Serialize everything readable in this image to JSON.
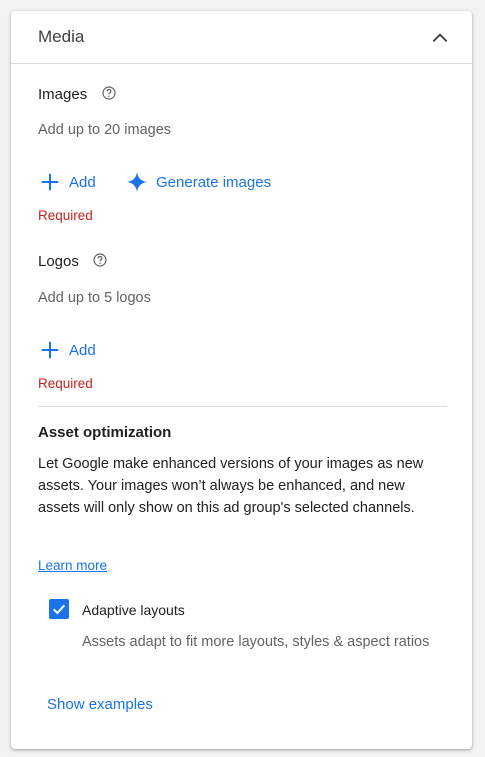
{
  "panel": {
    "title": "Media",
    "collapse_icon": "chevron-up-icon"
  },
  "images": {
    "title": "Images",
    "help_icon": "help-circle-icon",
    "hint": "Add up to 20 images",
    "add_label": "Add",
    "generate_label": "Generate images",
    "generate_icon": "sparkle-icon",
    "required": "Required"
  },
  "logos": {
    "title": "Logos",
    "help_icon": "help-circle-icon",
    "hint": "Add up to 5 logos",
    "add_label": "Add",
    "required": "Required"
  },
  "asset_optimization": {
    "title": "Asset optimization",
    "description": "Let Google make enhanced versions of your images as new assets. Your images won’t always be enhanced, and new assets will only show on this ad group's selected channels.",
    "learn_more": "Learn more",
    "adaptive_layouts": {
      "label": "Adaptive layouts",
      "checked": true,
      "description": "Assets adapt to fit more layouts, styles & aspect ratios"
    },
    "show_examples": "Show examples"
  },
  "colors": {
    "accent": "#1a73e8",
    "error": "#c5221f",
    "divider": "#dadce0"
  }
}
